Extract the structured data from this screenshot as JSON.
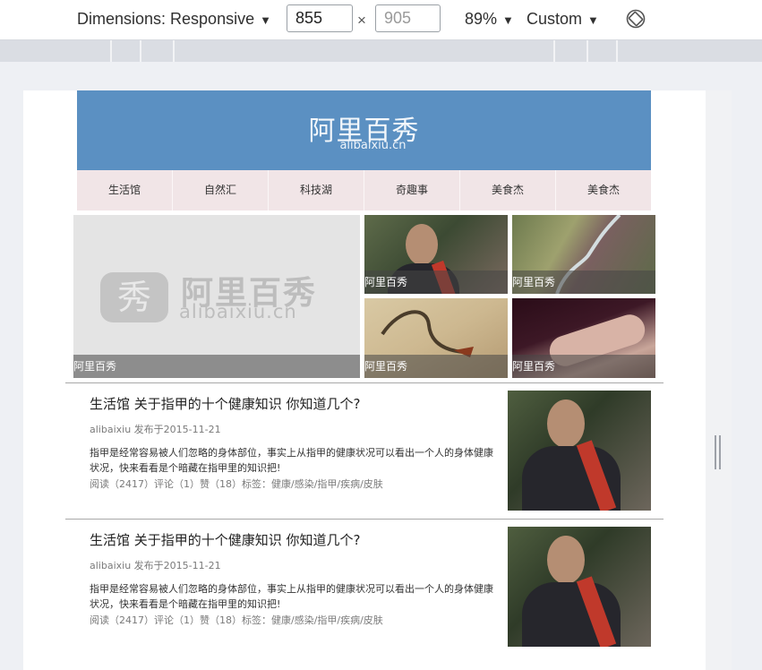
{
  "devtools": {
    "dimensions_label": "Dimensions: Responsive",
    "width_value": "855",
    "height_placeholder": "905",
    "times": "×",
    "zoom": "89%",
    "throttle": "Custom"
  },
  "site": {
    "logo_cn": "阿里百秀",
    "logo_en": "alibaixiu.cn",
    "nav": [
      "生活馆",
      "自然汇",
      "科技湖",
      "奇趣事",
      "美食杰",
      "美食杰"
    ],
    "gallery": {
      "watermark_cn": "阿里百秀",
      "watermark_en": "alibaixiu.cn",
      "watermark_glyph": "秀",
      "captions": [
        "阿里百秀",
        "阿里百秀",
        "阿里百秀",
        "阿里百秀",
        "阿里百秀"
      ]
    },
    "articles": [
      {
        "title": "生活馆 关于指甲的十个健康知识 你知道几个?",
        "meta": "alibaixiu 发布于2015-11-21",
        "summary": "指甲是经常容易被人们忽略的身体部位，事实上从指甲的健康状况可以看出一个人的身体健康状况，快来看看是个暗藏在指甲里的知识把!",
        "stats": "阅读（2417）评论（1）赞（18）标签：健康/感染/指甲/疾病/皮肤"
      },
      {
        "title": "生活馆 关于指甲的十个健康知识 你知道几个?",
        "meta": "alibaixiu 发布于2015-11-21",
        "summary": "指甲是经常容易被人们忽略的身体部位，事实上从指甲的健康状况可以看出一个人的身体健康状况，快来看看是个暗藏在指甲里的知识把!",
        "stats": "阅读（2417）评论（1）赞（18）标签：健康/感染/指甲/疾病/皮肤"
      }
    ]
  },
  "colors": {
    "header": "#5b90c2",
    "nav": "#f1e5e7"
  }
}
